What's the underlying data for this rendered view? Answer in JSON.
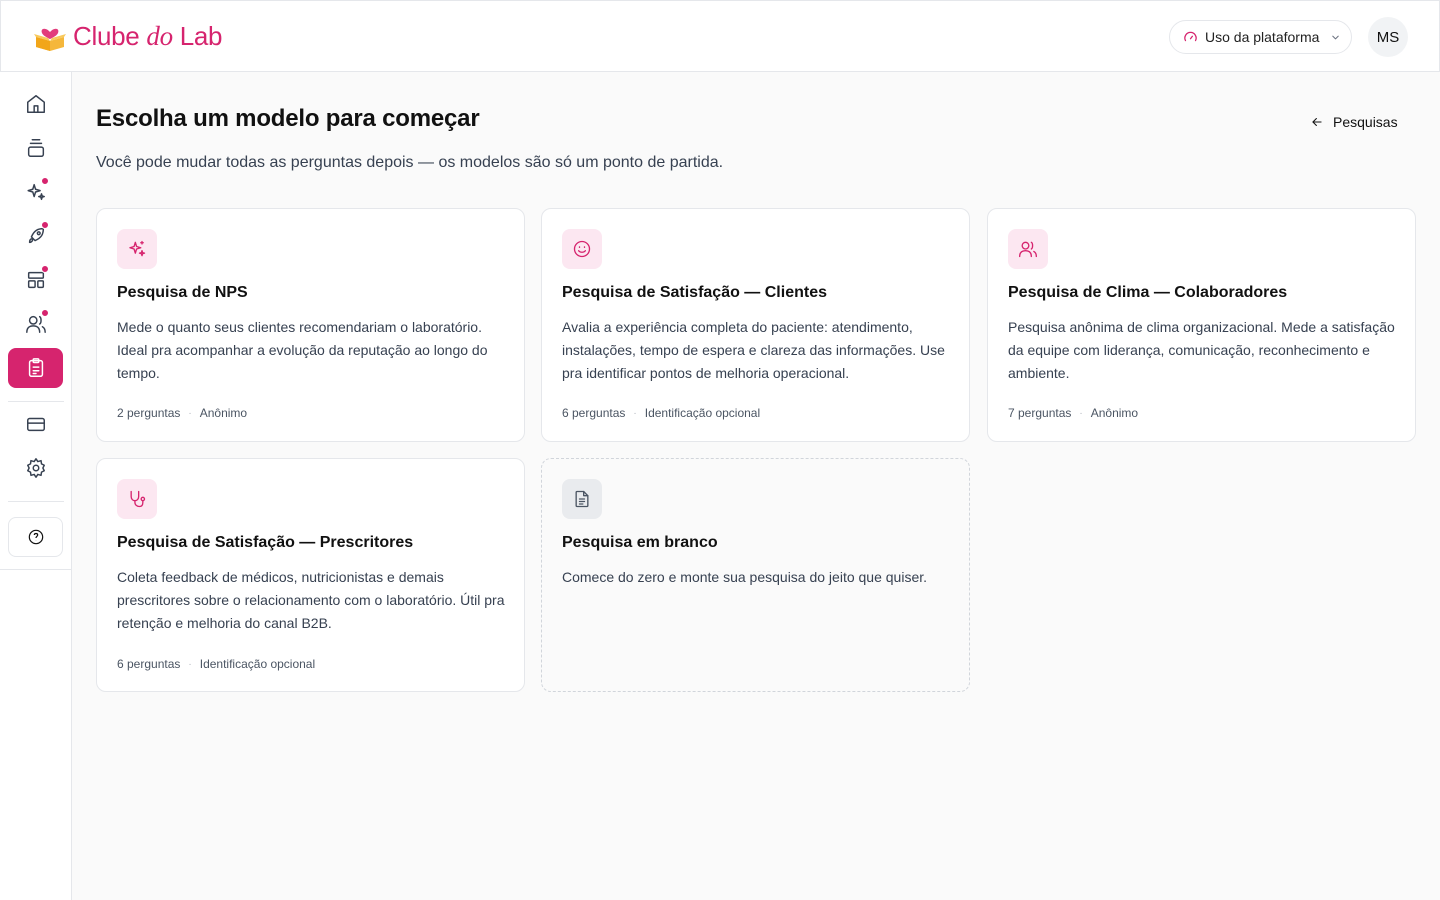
{
  "app": {
    "brand_main": "Clube",
    "brand_do": "do",
    "brand_end": "Lab",
    "accent_color": "#d6246e"
  },
  "header": {
    "usage_label": "Uso da plataforma",
    "usage_icon": "gauge-icon",
    "avatar_initials": "MS"
  },
  "sidebar": {
    "items": [
      {
        "name": "home",
        "icon": "home-icon",
        "badge": false,
        "active": false
      },
      {
        "name": "layers",
        "icon": "layers-icon",
        "badge": false,
        "active": false
      },
      {
        "name": "sparkles",
        "icon": "sparkles-icon",
        "badge": true,
        "active": false
      },
      {
        "name": "rocket",
        "icon": "rocket-icon",
        "badge": true,
        "active": false
      },
      {
        "name": "layout",
        "icon": "layout-icon",
        "badge": true,
        "active": false
      },
      {
        "name": "users",
        "icon": "users-icon",
        "badge": true,
        "active": false
      },
      {
        "name": "surveys",
        "icon": "clipboard-icon",
        "badge": false,
        "active": true
      },
      {
        "name": "billing",
        "icon": "credit-card-icon",
        "badge": false,
        "active": false
      },
      {
        "name": "settings",
        "icon": "gear-icon",
        "badge": false,
        "active": false
      }
    ],
    "help_icon": "help-circle-icon"
  },
  "main": {
    "title": "Escolha um modelo para começar",
    "subtitle": "Você pode mudar todas as perguntas depois — os modelos são só um ponto de partida.",
    "back_label": "Pesquisas"
  },
  "templates": [
    {
      "icon": "sparkles-icon",
      "title": "Pesquisa de NPS",
      "description": "Mede o quanto seus clientes recomendariam o laboratório. Ideal pra acompanhar a evolução da reputação ao longo do tempo.",
      "questions": "2 perguntas",
      "separator": "·",
      "privacy": "Anônimo"
    },
    {
      "icon": "smile-icon",
      "title": "Pesquisa de Satisfação — Clientes",
      "description": "Avalia a experiência completa do paciente: atendimento, instalações, tempo de espera e clareza das informações. Use pra identificar pontos de melhoria operacional.",
      "questions": "6 perguntas",
      "separator": "·",
      "privacy": "Identificação opcional"
    },
    {
      "icon": "users-icon",
      "title": "Pesquisa de Clima — Colaboradores",
      "description": "Pesquisa anônima de clima organizacional. Mede a satisfação da equipe com liderança, comunicação, reconhecimento e ambiente.",
      "questions": "7 perguntas",
      "separator": "·",
      "privacy": "Anônimo"
    },
    {
      "icon": "stethoscope-icon",
      "title": "Pesquisa de Satisfação — Prescritores",
      "description": "Coleta feedback de médicos, nutricionistas e demais prescritores sobre o relacionamento com o laboratório. Útil pra retenção e melhoria do canal B2B.",
      "questions": "6 perguntas",
      "separator": "·",
      "privacy": "Identificação opcional"
    },
    {
      "icon": "file-text-icon",
      "title": "Pesquisa em branco",
      "description": "Comece do zero e monte sua pesquisa do jeito que quiser."
    }
  ]
}
